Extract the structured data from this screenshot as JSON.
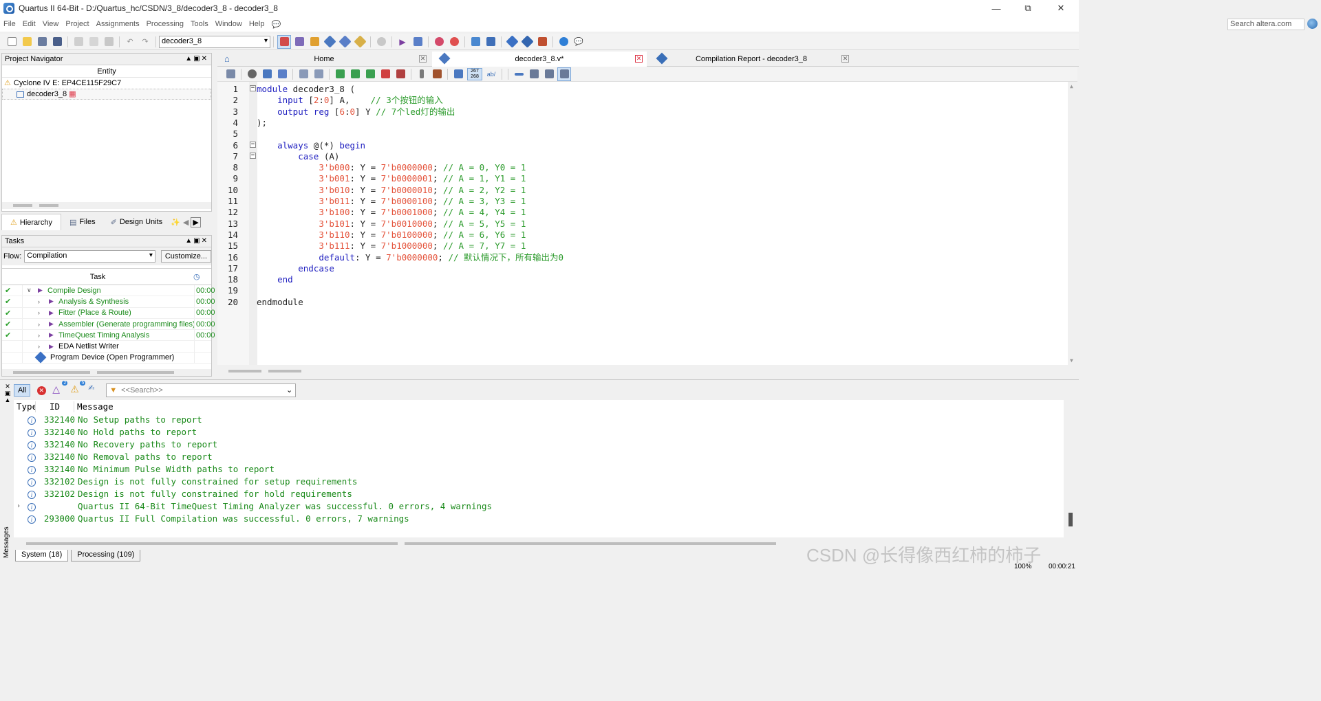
{
  "window": {
    "title": "Quartus II 64-Bit - D:/Quartus_hc/CSDN/3_8/decoder3_8 - decoder3_8"
  },
  "menu": {
    "file": "File",
    "edit": "Edit",
    "view": "View",
    "project": "Project",
    "assignments": "Assignments",
    "processing": "Processing",
    "tools": "Tools",
    "window": "Window",
    "help": "Help"
  },
  "search": {
    "placeholder": "Search altera.com"
  },
  "toolbar": {
    "project_combo": "decoder3_8"
  },
  "navigator": {
    "title": "Project Navigator",
    "column": "Entity",
    "device": "Cyclone IV E: EP4CE115F29C7",
    "top_entity": "decoder3_8",
    "tabs": {
      "hierarchy": "Hierarchy",
      "files": "Files",
      "design_units": "Design Units"
    }
  },
  "tasks": {
    "title": "Tasks",
    "flow_label": "Flow:",
    "flow_value": "Compilation",
    "customize": "Customize...",
    "col_task": "Task",
    "rows": [
      {
        "name": "Compile Design",
        "time": "00:00"
      },
      {
        "name": "Analysis & Synthesis",
        "time": "00:00"
      },
      {
        "name": "Fitter (Place & Route)",
        "time": "00:00"
      },
      {
        "name": "Assembler (Generate programming files)",
        "time": "00:00"
      },
      {
        "name": "TimeQuest Timing Analysis",
        "time": "00:00"
      },
      {
        "name": "EDA Netlist Writer",
        "time": ""
      },
      {
        "name": "Program Device (Open Programmer)",
        "time": ""
      }
    ]
  },
  "doc_tabs": {
    "home": "Home",
    "editor": "decoder3_8.v*",
    "report": "Compilation Report - decoder3_8"
  },
  "editor_toolbar": {
    "counter_top": "267",
    "counter_bottom": "268",
    "abc": "ab/"
  },
  "code": {
    "line_numbers": [
      "1",
      "2",
      "3",
      "4",
      "5",
      "6",
      "7",
      "8",
      "9",
      "10",
      "11",
      "12",
      "13",
      "14",
      "15",
      "16",
      "17",
      "18",
      "19",
      "20"
    ],
    "l1_kw": "module",
    "l1_rest": " decoder3_8 (",
    "l2_kw": "input",
    "l2_a": " [",
    "l2_n1": "2",
    "l2_b": ":",
    "l2_n2": "0",
    "l2_c": "] A,    ",
    "l2_cm": "// 3个按钮的输入",
    "l3_kw": "output",
    "l3_kw2": "reg",
    "l3_a": " [",
    "l3_n1": "6",
    "l3_b": ":",
    "l3_n2": "0",
    "l3_c": "] Y ",
    "l3_cm": "// 7个led灯的输出",
    "l4": ");",
    "l6_kw": "always",
    "l6_a": " @(*) ",
    "l6_kw2": "begin",
    "l7_kw": "case",
    "l7_a": " (A)",
    "cases": [
      {
        "sel": "3'b000",
        "val": "7'b0000000",
        "cm": "// A = 0, Y0 = 1"
      },
      {
        "sel": "3'b001",
        "val": "7'b0000001",
        "cm": "// A = 1, Y1 = 1"
      },
      {
        "sel": "3'b010",
        "val": "7'b0000010",
        "cm": "// A = 2, Y2 = 1"
      },
      {
        "sel": "3'b011",
        "val": "7'b0000100",
        "cm": "// A = 3, Y3 = 1"
      },
      {
        "sel": "3'b100",
        "val": "7'b0001000",
        "cm": "// A = 4, Y4 = 1"
      },
      {
        "sel": "3'b101",
        "val": "7'b0010000",
        "cm": "// A = 5, Y5 = 1"
      },
      {
        "sel": "3'b110",
        "val": "7'b0100000",
        "cm": "// A = 6, Y6 = 1"
      },
      {
        "sel": "3'b111",
        "val": "7'b1000000",
        "cm": "// A = 7, Y7 = 1"
      }
    ],
    "case_mid": ": Y = ",
    "l16_kw": "default",
    "l16_val": "7'b0000000",
    "l16_cm": "// 默认情况下，所有输出为0",
    "l17_kw": "endcase",
    "l18_kw": "end",
    "l20": "endmodule"
  },
  "messages": {
    "filter_all": "All",
    "badge_warn_purple": "2",
    "badge_warn_yellow": "5",
    "search_placeholder": "<<Search>>",
    "col_type": "Type",
    "col_id": "ID",
    "col_message": "Message",
    "rows": [
      {
        "id": "332140",
        "text": "No Setup paths to report"
      },
      {
        "id": "332140",
        "text": "No Hold paths to report"
      },
      {
        "id": "332140",
        "text": "No Recovery paths to report"
      },
      {
        "id": "332140",
        "text": "No Removal paths to report"
      },
      {
        "id": "332140",
        "text": "No Minimum Pulse Width paths to report"
      },
      {
        "id": "332102",
        "text": "Design is not fully constrained for setup requirements"
      },
      {
        "id": "332102",
        "text": "Design is not fully constrained for hold requirements"
      },
      {
        "id": "",
        "text": "Quartus II 64-Bit TimeQuest Timing Analyzer was successful. 0 errors, 4 warnings"
      },
      {
        "id": "293000",
        "text": "Quartus II Full Compilation was successful. 0 errors, 7 warnings"
      }
    ],
    "side_label": "Messages",
    "tab_system": "System (18)",
    "tab_processing": "Processing (109)"
  },
  "status": {
    "zoom": "100%",
    "elapsed": "00:00:21"
  },
  "watermark": "CSDN @长得像西红柿的柿子"
}
